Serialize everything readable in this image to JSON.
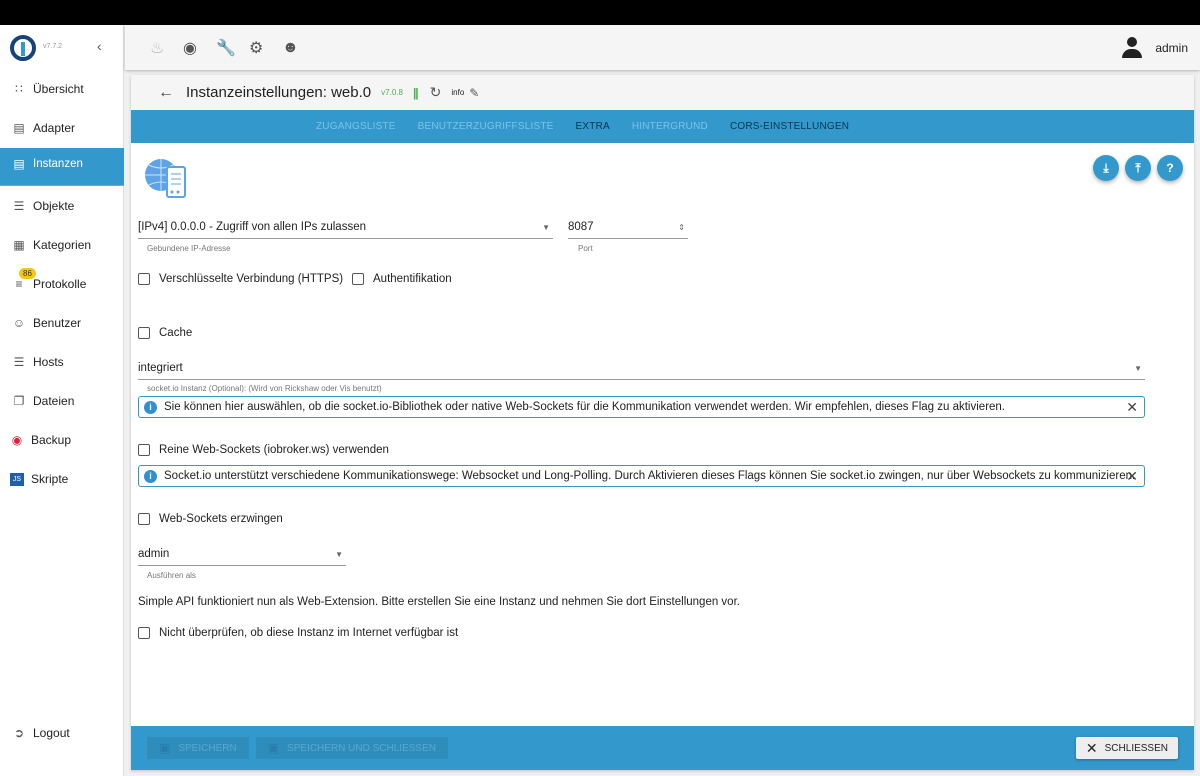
{
  "sidebar": {
    "version": "v7.7.2",
    "items": [
      {
        "label": "Übersicht",
        "icon": "apps-icon"
      },
      {
        "label": "Adapter",
        "icon": "store-icon"
      },
      {
        "label": "Instanzen",
        "icon": "instances-icon"
      },
      {
        "label": "Objekte",
        "icon": "list-icon"
      },
      {
        "label": "Kategorien",
        "icon": "category-icon"
      },
      {
        "label": "Protokolle",
        "icon": "log-icon",
        "badge": "86"
      },
      {
        "label": "Benutzer",
        "icon": "user-icon"
      },
      {
        "label": "Hosts",
        "icon": "hosts-icon"
      },
      {
        "label": "Dateien",
        "icon": "files-icon"
      },
      {
        "label": "Backup",
        "icon": "backup-icon"
      },
      {
        "label": "Skripte",
        "icon": "js-icon"
      }
    ],
    "logout": "Logout"
  },
  "topbar": {
    "user": "admin"
  },
  "header": {
    "title": "Instanzeinstellungen: web.0",
    "version": "v7.0.8",
    "info": "info"
  },
  "tabs": [
    "ZUGANGSLISTE",
    "BENUTZERZUGRIFFSLISTE",
    "EXTRA",
    "HINTERGRUND",
    "CORS-EINSTELLUNGEN"
  ],
  "form": {
    "ip": {
      "value": "[IPv4] 0.0.0.0 - Zugriff von allen IPs zulassen",
      "label": "Gebundene IP-Adresse"
    },
    "port": {
      "value": "8087",
      "label": "Port"
    },
    "https": "Verschlüsselte Verbindung (HTTPS)",
    "auth": "Authentifikation",
    "cache": "Cache",
    "socketio": {
      "value": "integriert",
      "label": "socket.io Instanz (Optional): (Wird von Rickshaw oder Vis benutzt)"
    },
    "info1": "Sie können hier auswählen, ob die socket.io-Bibliothek oder native Web-Sockets für die Kommunikation verwendet werden. Wir empfehlen, dieses Flag zu aktivieren.",
    "purews": "Reine Web-Sockets (iobroker.ws) verwenden",
    "info2": "Socket.io unterstützt verschiedene Kommunikationswege: Websocket und Long-Polling. Durch Aktivieren dieses Flags können Sie socket.io zwingen, nur über Websockets zu kommunizieren.",
    "forcews": "Web-Sockets erzwingen",
    "runas": {
      "value": "admin",
      "label": "Ausführen als"
    },
    "simpleapi": "Simple API funktioniert nun als Web-Extension. Bitte erstellen Sie eine Instanz und nehmen Sie dort Einstellungen vor.",
    "nocheck": "Nicht überprüfen, ob diese Instanz im Internet verfügbar ist"
  },
  "footer": {
    "save": "SPEICHERN",
    "save_close": "SPEICHERN UND SCHLIESSEN",
    "close": "SCHLIESSEN"
  }
}
